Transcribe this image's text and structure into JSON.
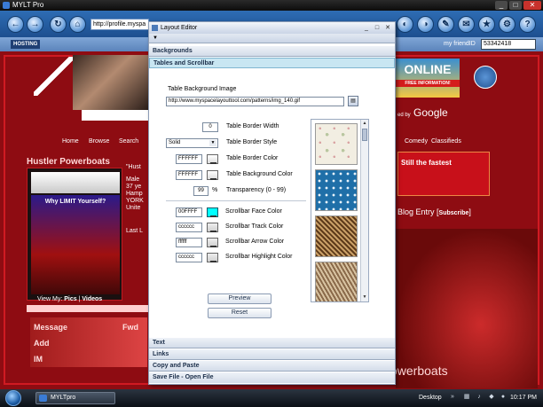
{
  "window": {
    "title": "MYLT Pro"
  },
  "toolbar": {
    "url": "http://profile.myspa",
    "hosting_label": "HOSTING",
    "friend_id_label": "my friendID",
    "friend_id_value": "53342418"
  },
  "page": {
    "nav": [
      "Home",
      "Browse",
      "Search"
    ],
    "nav_right": [
      "Comedy",
      "Classifieds"
    ],
    "ad_online": "ONLINE",
    "ad_online_sub": "FREE INFORMATION!",
    "google_prefix": "ed by",
    "google_word": "Google",
    "hustler_title": "Hustler Powerboats",
    "profile_lines": [
      "\"Hust",
      "Male",
      "37 ye",
      "Hamp",
      "YORK",
      "Unite",
      "",
      "Last L"
    ],
    "ad_text_1": "Why LIMIT Yourself?",
    "view_my_label": "View My:",
    "view_my_pics": "Pics",
    "view_my_videos": "Videos",
    "message_label": "Message",
    "fwd_label": "Fwd",
    "add_label": "Add",
    "im_label": "IM",
    "still_text": "Still the fastest",
    "blog_entry": "Blog Entry",
    "subscribe": "Subscribe",
    "powerboats": "owerboats"
  },
  "dialog": {
    "title": "Layout Editor",
    "sections": {
      "backgrounds": "Backgrounds",
      "tables": "Tables and Scrollbar",
      "text": "Text",
      "links": "Links",
      "copy": "Copy and Paste",
      "save": "Save File - Open File"
    },
    "table_bg_image_label": "Table Background Image",
    "table_bg_image_url": "http://www.myspacelayouttool.com/patterns/img_140.gif",
    "border_width_value": "0",
    "border_width_label": "Table Border Width",
    "border_style_value": "Solid",
    "border_style_label": "Table Border Style",
    "border_color_value": "FFFFFF",
    "border_color_label": "Table Border Color",
    "bg_color_value": "FFFFFF",
    "bg_color_label": "Table Background Color",
    "transparency_value": "99",
    "transparency_unit": "%",
    "transparency_label": "Transparency  (0 - 99)",
    "sb_face_value": "00FFFF",
    "sb_face_label": "Scrollbar Face Color",
    "sb_track_value": "cccccc",
    "sb_track_label": "Scrollbar Track Color",
    "sb_arrow_value": "ffffff",
    "sb_arrow_label": "Scrollbar Arrow Color",
    "sb_highlight_value": "cccccc",
    "sb_highlight_label": "Scrollbar Highlight Color",
    "preview_label": "Preview",
    "reset_label": "Reset"
  },
  "taskbar": {
    "item": "MYLTpro",
    "desktop": "Desktop",
    "time": "10:17 PM"
  },
  "colors": {
    "accent": "#2e6db4",
    "page_bg": "#8e0c12",
    "dialog_active": "#c8e6f2"
  }
}
